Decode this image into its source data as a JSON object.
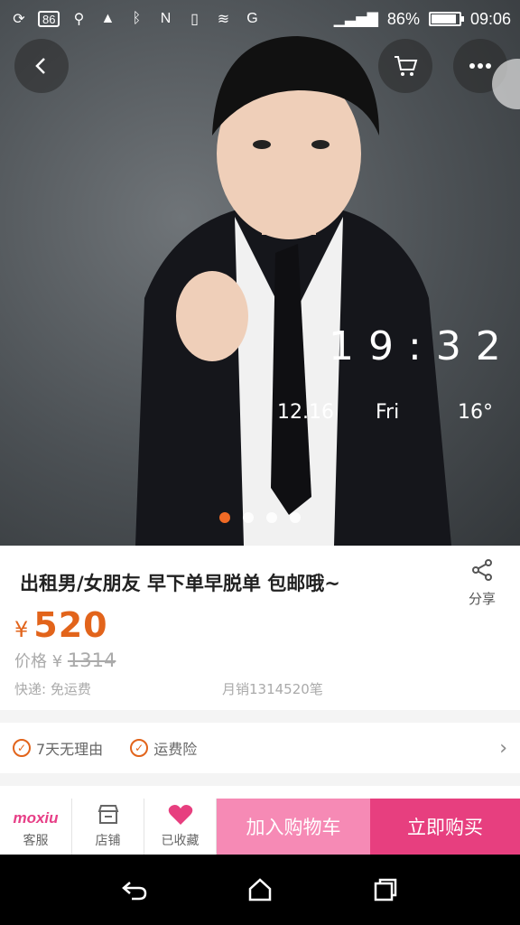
{
  "status_bar": {
    "notif_count": "86",
    "battery_text": "86%",
    "battery_level": 0.86,
    "time": "09:06"
  },
  "hero": {
    "clock_time": "19:32",
    "clock_date": "12.16",
    "clock_day": "Fri",
    "clock_temp": "16°",
    "carousel_total": 4,
    "carousel_active": 1
  },
  "product": {
    "title": "出租男/女朋友 早下单早脱单 包邮哦~",
    "share_label": "分享",
    "price_symbol": "¥",
    "price": "520",
    "orig_label": "价格",
    "orig_symbol": "¥",
    "orig_price": "1314",
    "shipping": "快递: 免运费",
    "monthly_sales": "月销1314520笔"
  },
  "services": {
    "items": [
      "7天无理由",
      "运费险"
    ]
  },
  "action_bar": {
    "brand": "moxiu",
    "service_label": "客服",
    "shop_label": "店铺",
    "favorite_label": "已收藏",
    "add_cart_label": "加入购物车",
    "buy_now_label": "立即购买"
  },
  "colors": {
    "accent_orange": "#e2641b",
    "pink_light": "#f68ab5",
    "pink_dark": "#e73f7f"
  }
}
